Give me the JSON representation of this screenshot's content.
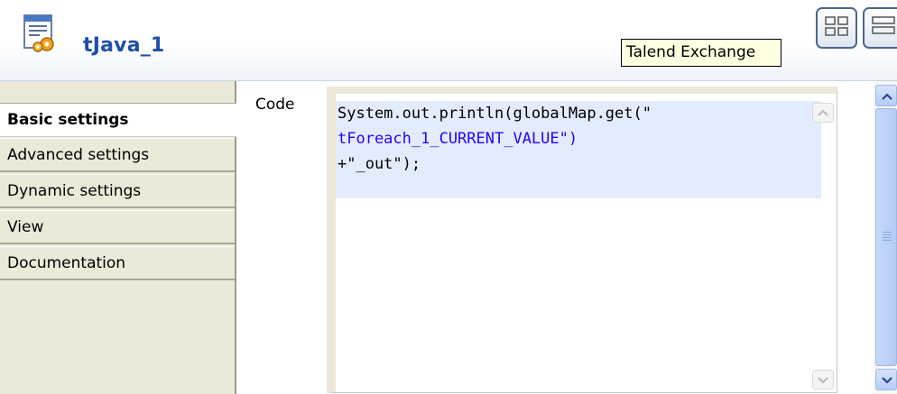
{
  "header": {
    "title": "tJava_1",
    "component_icon": "java-component-icon",
    "tooltip": "Talend Exchange",
    "buttons": [
      {
        "icon": "grid-layout-icon"
      },
      {
        "icon": "list-layout-icon"
      }
    ]
  },
  "sidebar": {
    "tabs": [
      {
        "label": "Basic settings",
        "active": true
      },
      {
        "label": "Advanced settings",
        "active": false
      },
      {
        "label": "Dynamic settings",
        "active": false
      },
      {
        "label": "View",
        "active": false
      },
      {
        "label": "Documentation",
        "active": false
      }
    ]
  },
  "main": {
    "code_label": "Code",
    "code_lines": [
      "System.out.println(globalMap.get(\"",
      "tForeach_1_CURRENT_VALUE\")",
      "+\"_out\");"
    ]
  },
  "colors": {
    "title": "#1e4fa8",
    "tab_bg": "#ece9d8",
    "selection": "#e3ecfd",
    "string": "#2a00ff",
    "tooltip_bg": "#ffffe1"
  }
}
